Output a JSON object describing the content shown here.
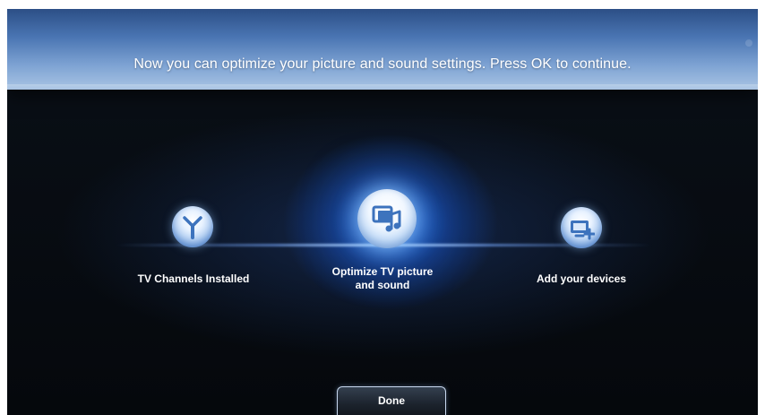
{
  "header": {
    "message": "Now you can optimize your picture and sound settings. Press OK to continue."
  },
  "steps": [
    {
      "label_line1": "TV Channels Installed",
      "label_line2": "",
      "icon": "antenna-icon",
      "active": false
    },
    {
      "label_line1": "Optimize TV picture",
      "label_line2": "and sound",
      "icon": "picture-sound-icon",
      "active": true
    },
    {
      "label_line1": "Add your devices",
      "label_line2": "",
      "icon": "add-device-icon",
      "active": false
    }
  ],
  "footer": {
    "done_label": "Done"
  },
  "colors": {
    "header_blue": "#4a75b3",
    "glow_blue": "#1e78ff",
    "background": "#05080c"
  }
}
